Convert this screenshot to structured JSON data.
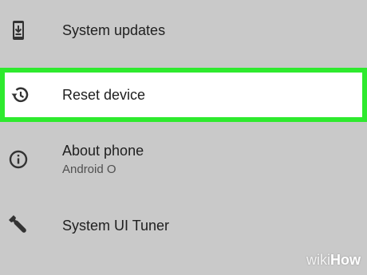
{
  "settings": {
    "items": [
      {
        "title": "System updates",
        "icon": "system-update-icon"
      },
      {
        "title": "Reset device",
        "icon": "restore-history-icon",
        "highlighted": true
      },
      {
        "title": "About phone",
        "subtitle": "Android O",
        "icon": "info-icon"
      },
      {
        "title": "System UI Tuner",
        "icon": "wrench-icon"
      }
    ]
  },
  "colors": {
    "background": "#c9c9c9",
    "highlight_border": "#2eea2e",
    "highlight_fill": "#ffffff",
    "text": "#202020",
    "icon": "#333333"
  },
  "watermark": {
    "brand_part1": "wiki",
    "brand_part2": "How"
  }
}
